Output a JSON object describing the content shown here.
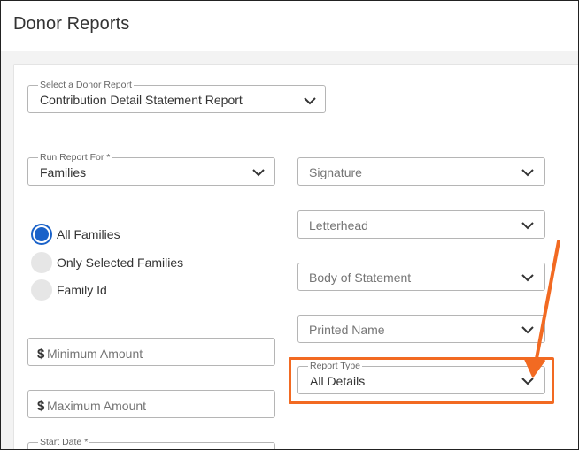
{
  "header": {
    "title": "Donor Reports"
  },
  "form": {
    "donor_report": {
      "label": "Select a Donor Report",
      "value": "Contribution Detail Statement Report"
    },
    "run_report_for": {
      "label": "Run Report For *",
      "value": "Families"
    },
    "radio_options": [
      {
        "label": "All Families",
        "checked": true
      },
      {
        "label": "Only Selected Families",
        "checked": false
      },
      {
        "label": "Family Id",
        "checked": false
      }
    ],
    "minimum_amount": {
      "placeholder": "Minimum Amount",
      "currency_symbol": "$"
    },
    "maximum_amount": {
      "placeholder": "Maximum Amount",
      "currency_symbol": "$"
    },
    "start_date": {
      "label": "Start Date *"
    },
    "signature": {
      "placeholder": "Signature"
    },
    "letterhead": {
      "placeholder": "Letterhead"
    },
    "body_of_statement": {
      "placeholder": "Body of Statement"
    },
    "printed_name": {
      "placeholder": "Printed Name"
    },
    "report_type": {
      "label": "Report Type",
      "value": "All Details"
    }
  },
  "annotation": {
    "color": "#f26a22"
  },
  "colors": {
    "radio_selected": "#1a62c9",
    "field_border": "#b5b5b5"
  }
}
